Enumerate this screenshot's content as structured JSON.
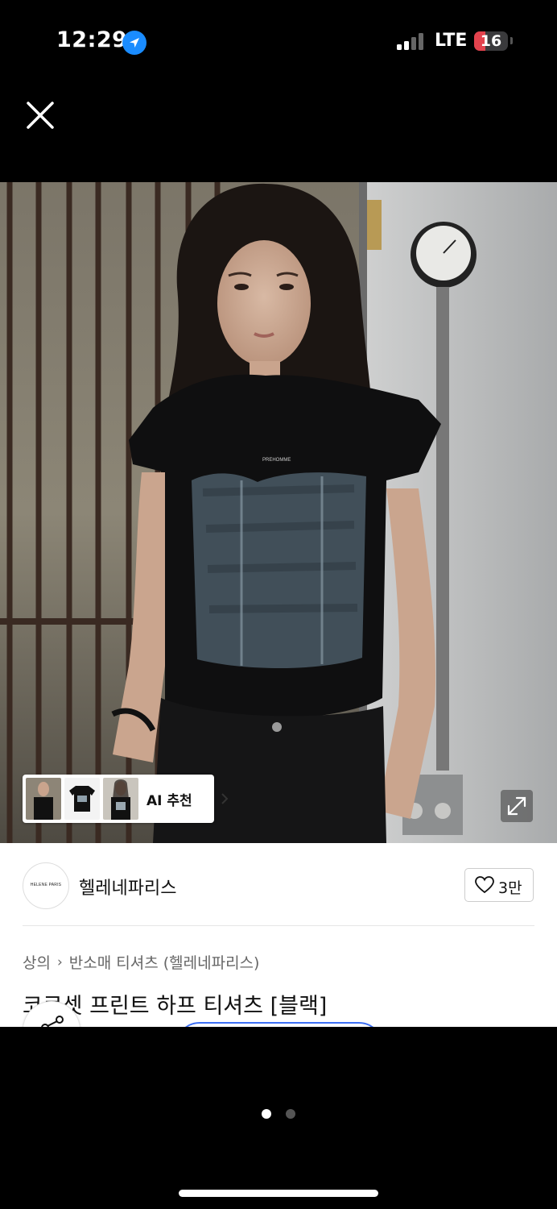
{
  "status_bar": {
    "time": "12:29",
    "network": "LTE",
    "battery": "16",
    "battery_color": "#e3424d"
  },
  "viewer": {
    "close_icon": "close-icon",
    "expand_icon": "expand-icon",
    "page_count": 2,
    "current_page": 1
  },
  "ai_recommend": {
    "label": "AI 추천",
    "chevron_icon": "chevron-right-icon"
  },
  "product": {
    "brand": {
      "name": "헬레네파리스",
      "logo_text": "HELENE PARIS",
      "likes": "3만"
    },
    "breadcrumb": [
      "상의",
      "반소매 티셔츠 (헬레네파리스)"
    ],
    "title": "코르셋 프린트 하프 티셔츠 [블랙]",
    "shirt_print_text": "PREHOMME"
  },
  "colors": {
    "accent": "#3c6ff5",
    "location_blue": "#1a8cff"
  }
}
